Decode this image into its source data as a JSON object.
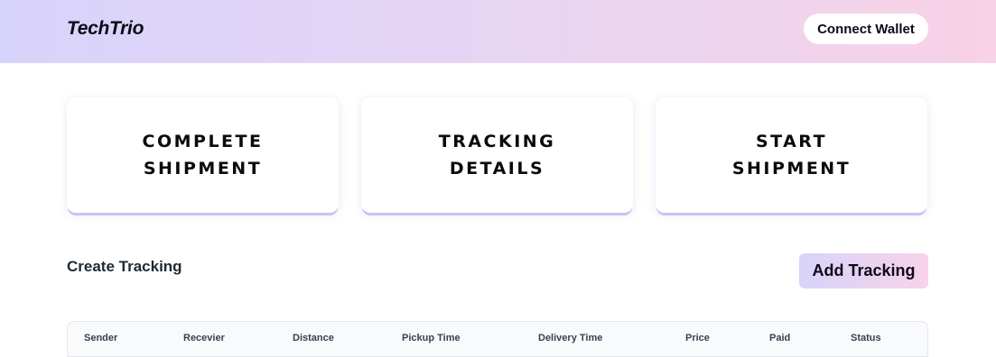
{
  "navbar": {
    "brand": "TechTrio",
    "connect_label": "Connect Wallet"
  },
  "cards": [
    {
      "line1": "COMPLETE",
      "line2": "SHIPMENT"
    },
    {
      "line1": "TRACKING",
      "line2": "DETAILS"
    },
    {
      "line1": "START",
      "line2": "SHIPMENT"
    }
  ],
  "section": {
    "title": "Create Tracking",
    "add_label": "Add Tracking"
  },
  "table": {
    "columns": [
      "Sender",
      "Recevier",
      "Distance",
      "Pickup Time",
      "Delivery Time",
      "Price",
      "Paid",
      "Status"
    ]
  }
}
